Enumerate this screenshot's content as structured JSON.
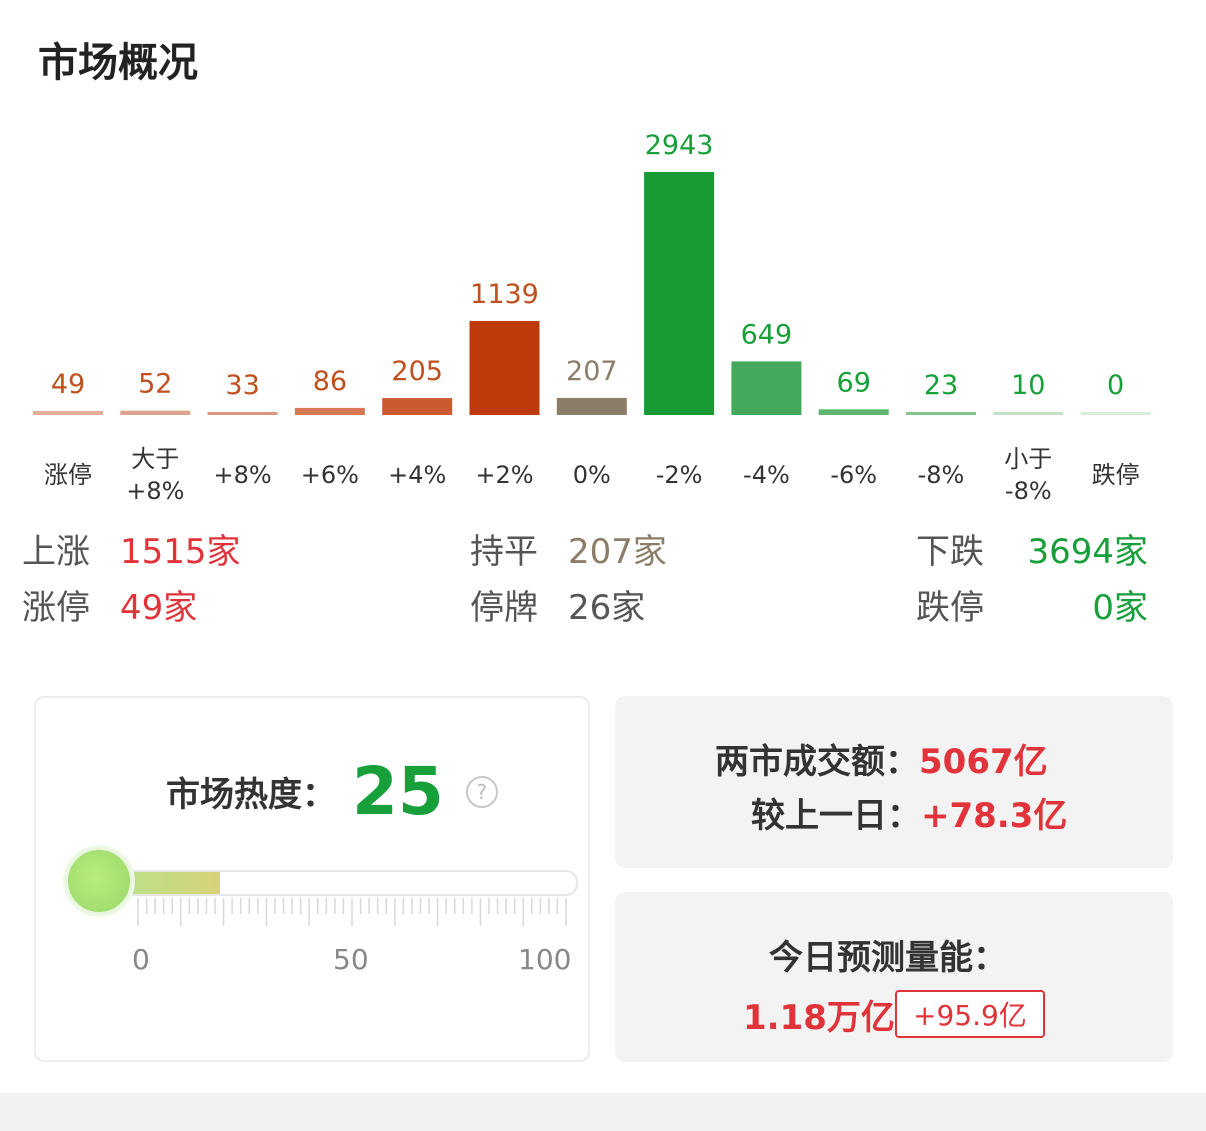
{
  "title": "市场概况",
  "chart_data": {
    "type": "bar",
    "categories": [
      [
        "涨停"
      ],
      [
        "大于",
        "+8%"
      ],
      [
        "+8%"
      ],
      [
        "+6%"
      ],
      [
        "+4%"
      ],
      [
        "+2%"
      ],
      [
        "0%"
      ],
      [
        "-2%"
      ],
      [
        "-4%"
      ],
      [
        "-6%"
      ],
      [
        "-8%"
      ],
      [
        "小于",
        "-8%"
      ],
      [
        "跌停"
      ]
    ],
    "values": [
      49,
      52,
      33,
      86,
      205,
      1139,
      207,
      2943,
      649,
      69,
      23,
      10,
      0
    ],
    "colors": [
      "#e2b09a",
      "#dca48c",
      "#d99780",
      "#d47855",
      "#cc5a30",
      "#be3a0a",
      "#8b7d68",
      "#189a35",
      "#42a85a",
      "#5db56f",
      "#82c48f",
      "#c4e0c8",
      "#d8ecda"
    ],
    "label_colors": [
      "#c0501e",
      "#c0501e",
      "#c0501e",
      "#c0501e",
      "#c0501e",
      "#c0501e",
      "#8b7d68",
      "#17a03a",
      "#17a03a",
      "#17a03a",
      "#17a03a",
      "#17a03a",
      "#17a03a"
    ]
  },
  "stats": {
    "up_label": "上涨",
    "up_value": "1515家",
    "flat_label": "持平",
    "flat_value": "207家",
    "down_label": "下跌",
    "down_value": "3694家",
    "limit_up_label": "涨停",
    "limit_up_value": "49家",
    "suspended_label": "停牌",
    "suspended_value": "26家",
    "limit_down_label": "跌停",
    "limit_down_value": "0家"
  },
  "heat": {
    "label": "市场热度：",
    "value": "25",
    "level": 25,
    "help": "?",
    "scale": [
      "0",
      "50",
      "100"
    ]
  },
  "turnover": {
    "label": "两市成交额：",
    "value": "5067亿",
    "compare_label": "较上一日：",
    "compare_value": "+78.3亿"
  },
  "forecast": {
    "label": "今日预测量能：",
    "value": "1.18万亿",
    "delta": "+95.9亿"
  },
  "colors": {
    "red": "#e0343a",
    "green": "#17a03a",
    "gray": "#8b7d68"
  }
}
